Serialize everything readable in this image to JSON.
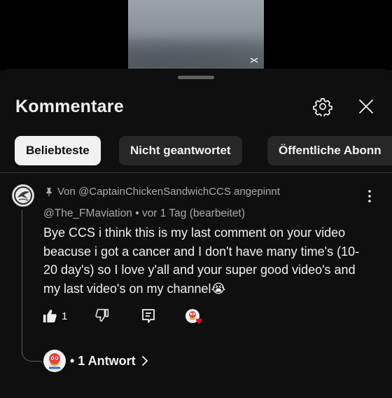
{
  "header": {
    "title": "Kommentare",
    "settings_icon": "gear-icon",
    "close_icon": "close-icon"
  },
  "filters": [
    {
      "label": "Beliebteste",
      "active": true
    },
    {
      "label": "Nicht geantwortet",
      "active": false
    },
    {
      "label": "Öffentliche Abonn",
      "active": false
    }
  ],
  "comment": {
    "pinned_text": "Von @CaptainChickenSandwichCCS angepinnt",
    "author": "@The_FMaviation",
    "time": "vor 1 Tag (bearbeitet)",
    "meta_separator": "•",
    "text": "Bye CCS i think this is my last comment on your video beacuse i got a cancer and I don't have many time's (10-20 day's) so I love y'all and your super good video's and my last video's on my channel😭",
    "like_count": "1",
    "replies_label": "• 1 Antwort"
  },
  "colors": {
    "background": "#0f0f0f",
    "chip_active_bg": "#f1f1f1",
    "chip_bg": "#272727",
    "secondary_text": "#aaaaaa",
    "heart": "#ff0033"
  }
}
